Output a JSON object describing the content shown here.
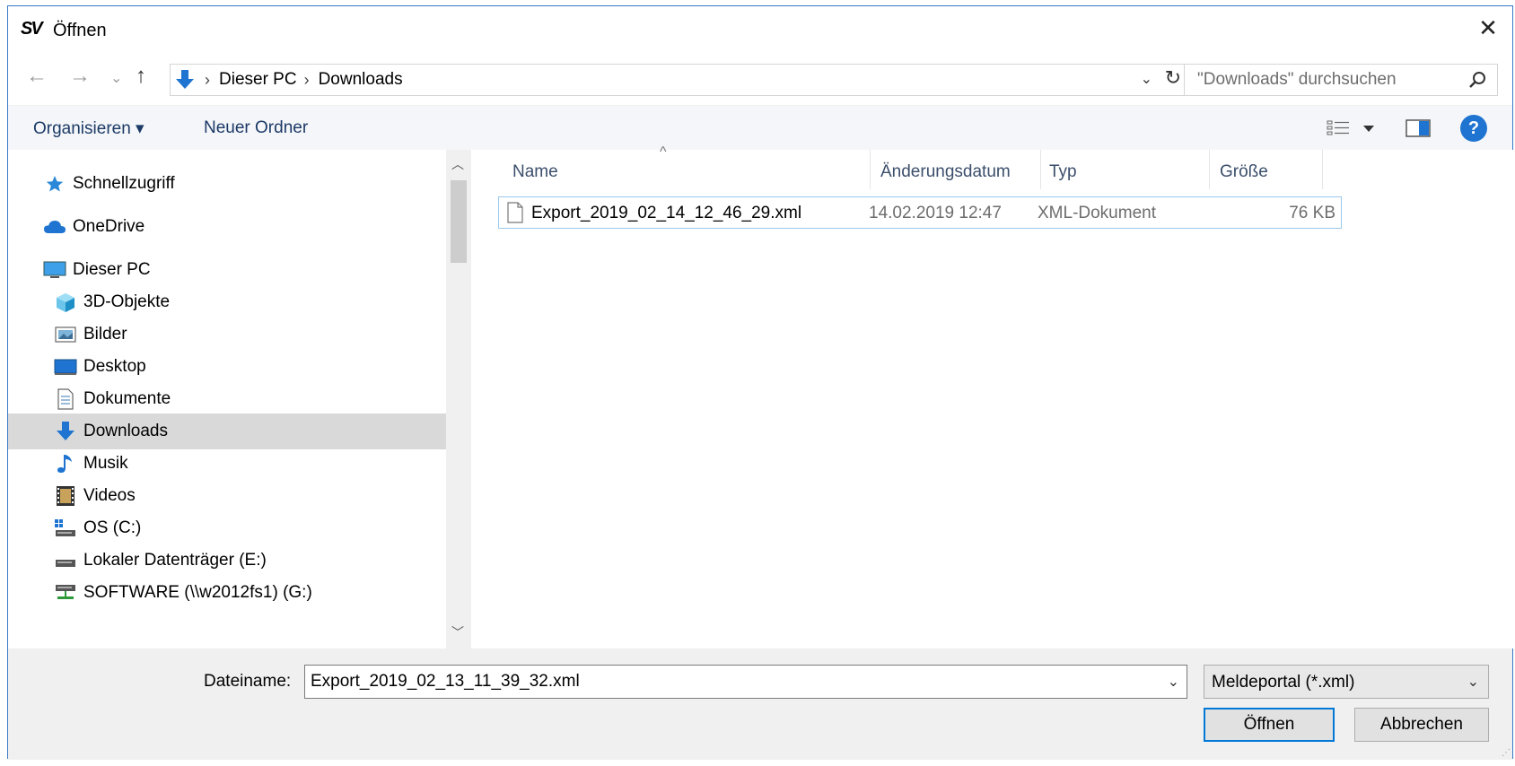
{
  "window": {
    "logo_text": "SV",
    "title": "Öffnen",
    "close_glyph": "✕"
  },
  "navigation": {
    "back_glyph": "←",
    "forward_glyph": "→",
    "recent_glyph": "⌄",
    "up_glyph": "↑"
  },
  "address": {
    "crumbs": [
      "Dieser PC",
      "Downloads"
    ],
    "separator": "›",
    "dropdown_glyph": "⌄",
    "refresh_glyph": "↻"
  },
  "search": {
    "placeholder": "\"Downloads\" durchsuchen"
  },
  "toolbar": {
    "organize_label": "Organisieren ▾",
    "new_folder_label": "Neuer Ordner",
    "help_label": "?"
  },
  "sidebar": {
    "items": [
      {
        "label": "Schnellzugriff",
        "icon": "star-icon"
      },
      {
        "label": "OneDrive",
        "icon": "cloud-icon"
      },
      {
        "label": "Dieser PC",
        "icon": "computer-icon"
      },
      {
        "label": "3D-Objekte",
        "icon": "cube-icon"
      },
      {
        "label": "Bilder",
        "icon": "pictures-icon"
      },
      {
        "label": "Desktop",
        "icon": "desktop-icon"
      },
      {
        "label": "Dokumente",
        "icon": "document-icon"
      },
      {
        "label": "Downloads",
        "icon": "download-icon",
        "selected": true
      },
      {
        "label": "Musik",
        "icon": "music-icon"
      },
      {
        "label": "Videos",
        "icon": "video-icon"
      },
      {
        "label": "OS (C:)",
        "icon": "drive-os-icon"
      },
      {
        "label": "Lokaler Datenträger (E:)",
        "icon": "drive-icon"
      },
      {
        "label": "SOFTWARE (\\\\w2012fs1) (G:)",
        "icon": "network-drive-icon"
      }
    ],
    "scroll_up_glyph": "︿",
    "scroll_down_glyph": "﹀"
  },
  "file_list": {
    "columns": [
      "Name",
      "Änderungsdatum",
      "Typ",
      "Größe"
    ],
    "sort_glyph": "^",
    "rows": [
      {
        "name": "Export_2019_02_14_12_46_29.xml",
        "date": "14.02.2019 12:47",
        "type": "XML-Dokument",
        "size": "76 KB"
      }
    ]
  },
  "footer": {
    "filename_label": "Dateiname:",
    "filename_value": "Export_2019_02_13_11_39_32.xml",
    "filename_dropdown_glyph": "⌄",
    "filetype_value": "Meldeportal (*.xml)",
    "filetype_dropdown_glyph": "⌄",
    "open_label": "Öffnen",
    "cancel_label": "Abbrechen"
  },
  "colors": {
    "accent": "#0078d7",
    "selection": "#d9d9d9",
    "toolbar_text": "#1c3a66"
  }
}
